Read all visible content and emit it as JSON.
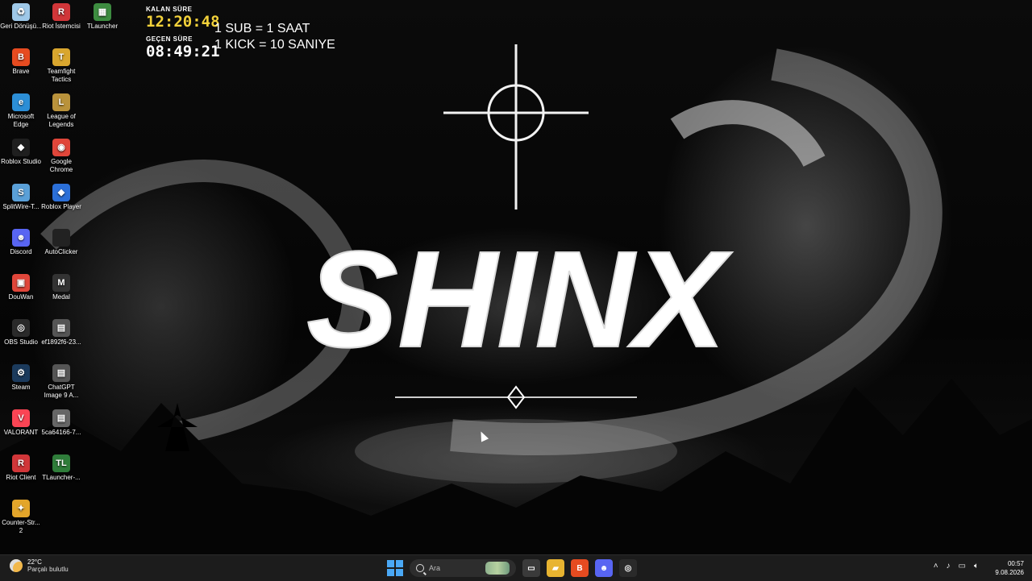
{
  "desktop_icons": [
    {
      "label": "Geri Dönüşü...",
      "icon": "recycle-bin-icon",
      "color": "#9ec8e8",
      "glyph": "♻"
    },
    {
      "label": "Riot İstemcisi",
      "icon": "riot-client-icon",
      "color": "#d13639",
      "glyph": "R"
    },
    {
      "label": "TLauncher",
      "icon": "tlauncher-icon",
      "color": "#3d8c40",
      "glyph": "▦"
    },
    {
      "label": "Brave",
      "icon": "brave-icon",
      "color": "#e64b20",
      "glyph": "B"
    },
    {
      "label": "Teamfight Tactics",
      "icon": "teamfight-tactics-icon",
      "color": "#d9a62e",
      "glyph": "T"
    },
    {
      "label": "Microsoft Edge",
      "icon": "edge-icon",
      "color": "#2c8ed6",
      "glyph": "e"
    },
    {
      "label": "League of Legends",
      "icon": "league-of-legends-icon",
      "color": "#b9923b",
      "glyph": "L"
    },
    {
      "label": "Roblox Studio",
      "icon": "roblox-studio-icon",
      "color": "#1f1f1f",
      "glyph": "◆"
    },
    {
      "label": "Google Chrome",
      "icon": "chrome-icon",
      "color": "#e0463a",
      "glyph": "◉"
    },
    {
      "label": "SplitWire-T...",
      "icon": "splitwire-icon",
      "color": "#5aa0d8",
      "glyph": "S"
    },
    {
      "label": "Roblox Player",
      "icon": "roblox-player-icon",
      "color": "#2b6fd8",
      "glyph": "◆"
    },
    {
      "label": "Discord",
      "icon": "discord-icon",
      "color": "#5865f2",
      "glyph": "☻"
    },
    {
      "label": "AutoClicker",
      "icon": "autoclicker-icon",
      "color": "#222222",
      "glyph": ""
    },
    {
      "label": "DouWan",
      "icon": "douwan-icon",
      "color": "#e0463a",
      "glyph": "▣"
    },
    {
      "label": "Medal",
      "icon": "medal-icon",
      "color": "#333333",
      "glyph": "M"
    },
    {
      "label": "OBS Studio",
      "icon": "obs-studio-icon",
      "color": "#2a2a2a",
      "glyph": "◎"
    },
    {
      "label": "ef1892f6-23...",
      "icon": "image-file-icon",
      "color": "#555555",
      "glyph": "▤"
    },
    {
      "label": "Steam",
      "icon": "steam-icon",
      "color": "#1b3a5c",
      "glyph": "⚙"
    },
    {
      "label": "ChatGPT Image 9 A...",
      "icon": "image-file-icon",
      "color": "#555555",
      "glyph": "▤"
    },
    {
      "label": "VALORANT",
      "icon": "valorant-icon",
      "color": "#fa4454",
      "glyph": "V"
    },
    {
      "label": "5ca64166-7...",
      "icon": "image-file-icon",
      "color": "#666666",
      "glyph": "▤"
    },
    {
      "label": "Riot Client",
      "icon": "riot-client-icon",
      "color": "#d13639",
      "glyph": "R"
    },
    {
      "label": "TLauncher-...",
      "icon": "tlauncher-icon",
      "color": "#2f7d3a",
      "glyph": "TL"
    },
    {
      "label": "Counter-Str... 2",
      "icon": "counter-strike-icon",
      "color": "#e3a52a",
      "glyph": "✦"
    }
  ],
  "timer": {
    "remaining_label": "KALAN SÜRE",
    "remaining_value": "12:20:48",
    "elapsed_label": "GEÇEN SÜRE",
    "elapsed_value": "08:49:21",
    "remaining_color": "#f2d13a"
  },
  "rules": {
    "line1": "1 SUB = 1 SAAT",
    "line2": "1 KICK = 10 SANIYE"
  },
  "wallpaper": {
    "title": "SHINX"
  },
  "taskbar": {
    "weather_temp": "22°C",
    "weather_desc": "Parçalı bulutlu",
    "search_placeholder": "Ara",
    "apps": [
      {
        "name": "task-view",
        "icon": "task-view-icon",
        "color": "#3a3a3a",
        "glyph": "▭"
      },
      {
        "name": "file-explorer",
        "icon": "folder-icon",
        "color": "#e8b430",
        "glyph": "▰"
      },
      {
        "name": "brave",
        "icon": "brave-icon",
        "color": "#e64b20",
        "glyph": "B"
      },
      {
        "name": "discord",
        "icon": "discord-icon",
        "color": "#5865f2",
        "glyph": "☻"
      },
      {
        "name": "obs",
        "icon": "obs-studio-icon",
        "color": "#2a2a2a",
        "glyph": "◎"
      }
    ],
    "time": "00:57",
    "date": "9.08.2026"
  }
}
